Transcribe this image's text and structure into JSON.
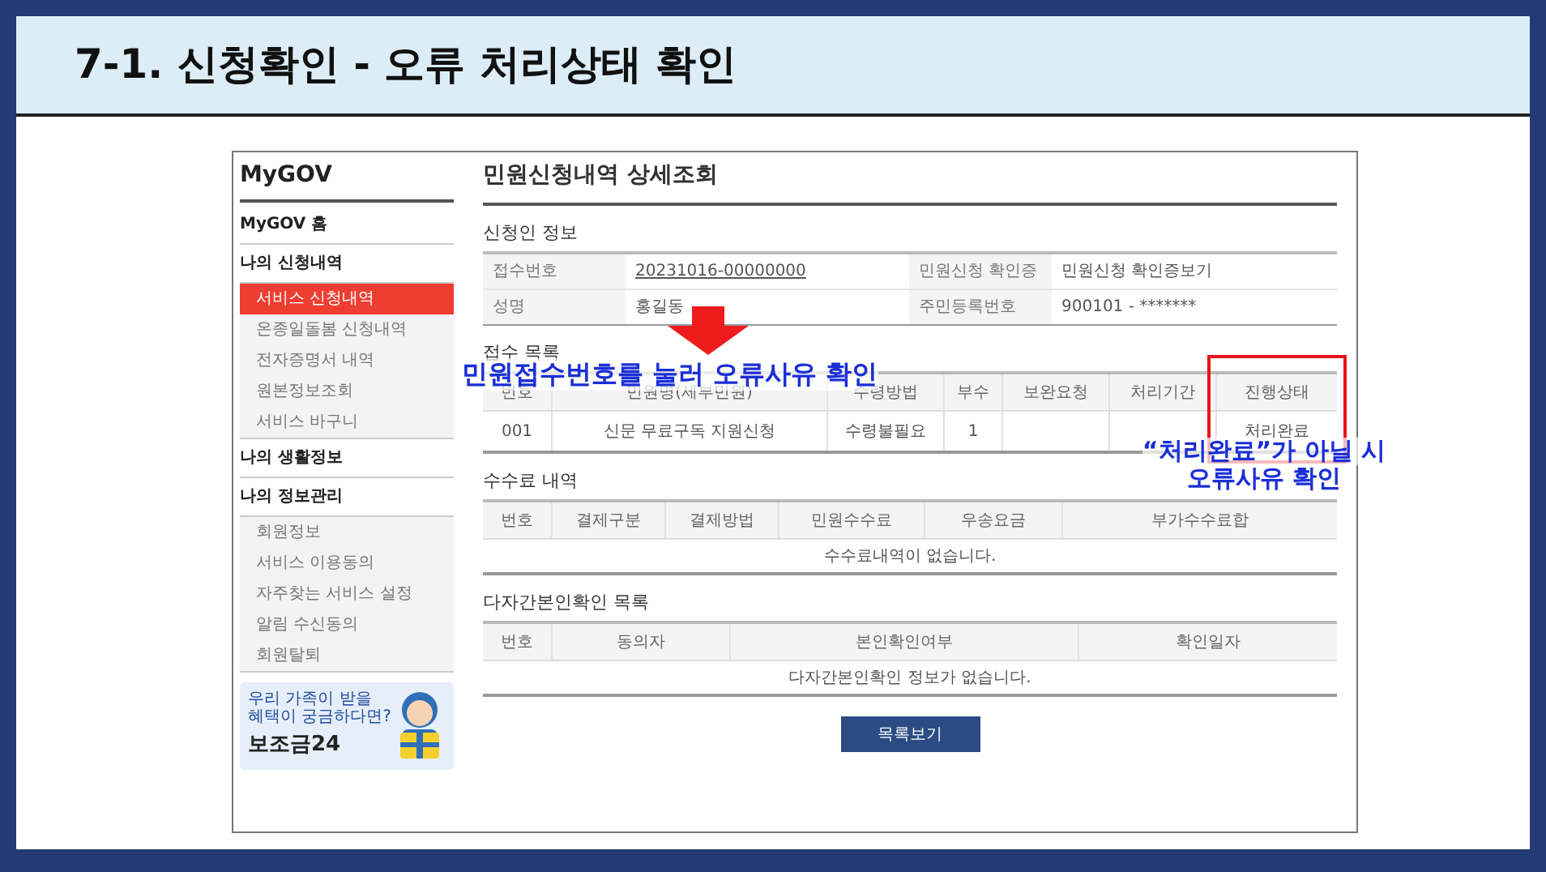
{
  "slide": {
    "title": "7-1.  신청확인 - 오류 처리상태 확인"
  },
  "sidebar": {
    "title": "MyGOV",
    "sections": [
      {
        "label": "MyGOV 홈"
      },
      {
        "label": "나의 신청내역",
        "children": [
          {
            "label": "서비스 신청내역",
            "selected": true
          },
          {
            "label": "온종일돌봄 신청내역",
            "selected": false
          },
          {
            "label": "전자증명서 내역",
            "selected": false
          },
          {
            "label": "원본정보조회",
            "selected": false
          },
          {
            "label": "서비스 바구니",
            "selected": false
          }
        ]
      },
      {
        "label": "나의 생활정보"
      },
      {
        "label": "나의 정보관리",
        "children": [
          {
            "label": "회원정보",
            "selected": false
          },
          {
            "label": "서비스 이용동의",
            "selected": false
          },
          {
            "label": "자주찾는 서비스 설정",
            "selected": false
          },
          {
            "label": "알림 수신동의",
            "selected": false
          },
          {
            "label": "회원탈퇴",
            "selected": false
          }
        ]
      }
    ],
    "banner": {
      "lines": [
        "우리 가족이 받을",
        "혜택이 궁금하다면?"
      ],
      "brand": "보조금24"
    }
  },
  "main": {
    "title": "민원신청내역 상세조회",
    "applicant": {
      "heading": "신청인 정보",
      "rows": [
        [
          "접수번호",
          "20231016-00000000",
          "민원신청 확인증",
          "민원신청 확인증보기"
        ],
        [
          "성명",
          "홍길동",
          "주민등록번호",
          "900101 - *******"
        ]
      ]
    },
    "receipts": {
      "heading": "접수 목록",
      "columns": [
        "번호",
        "민원명(세부민원)",
        "수령방법",
        "부수",
        "보완요청",
        "처리기간",
        "진행상태"
      ],
      "rows": [
        [
          "001",
          "신문 무료구독 지원신청",
          "수령불필요",
          "1",
          "",
          "",
          "처리완료"
        ]
      ]
    },
    "fees": {
      "heading": "수수료 내역",
      "columns": [
        "번호",
        "결제구분",
        "결제방법",
        "민원수수료",
        "우송요금",
        "부가수수료합"
      ],
      "empty": "수수료내역이 없습니다."
    },
    "identity": {
      "heading": "다자간본인확인 목록",
      "columns": [
        "번호",
        "동의자",
        "본인확인여부",
        "확인일자"
      ],
      "empty": "다자간본인확인 정보가 없습니다."
    },
    "button": "목록보기"
  },
  "annotations": [
    {
      "kind": "arrow",
      "lines": [
        "민원접수번호를 눌러 오류사유 확인"
      ]
    },
    {
      "kind": "note",
      "lines": [
        "“처리완료”가 아닐 시",
        "오류사유 확인"
      ]
    }
  ]
}
